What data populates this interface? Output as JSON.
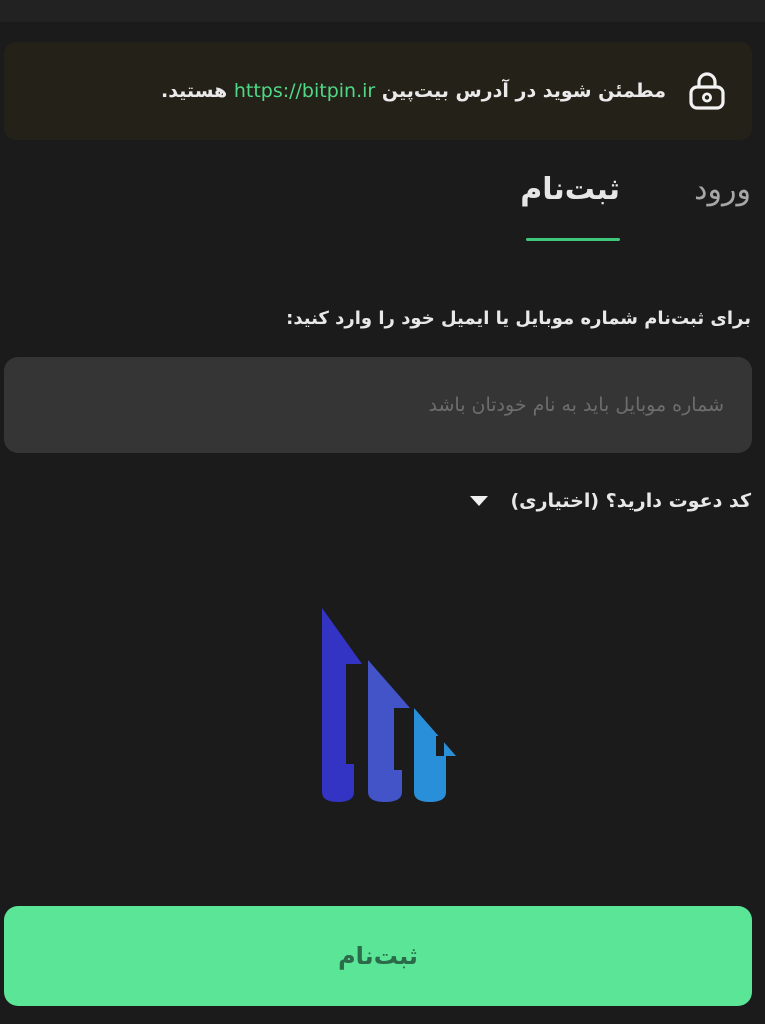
{
  "notice": {
    "text_before": "مطمئن شوید در آدرس بیت‌پین",
    "url": "https://bitpin.ir",
    "text_after": "هستید.",
    "icon": "lock-icon"
  },
  "tabs": {
    "login_label": "ورود",
    "register_label": "ثبت‌نام",
    "active": "register"
  },
  "form": {
    "phone_label": "برای ثبت‌نام شماره موبایل یا ایمیل خود را وارد کنید:",
    "phone_placeholder": "شماره موبایل باید به نام خودتان باشد",
    "phone_value": "",
    "referral_label": "کد دعوت دارید؟ (اختیاری)",
    "referral_icon": "caret-down-icon",
    "submit_label": "ثبت‌نام"
  },
  "colors": {
    "accent": "#5ae597",
    "url_green": "#4fd987",
    "background": "#1b1b1b",
    "notice_background": "#242119",
    "input_background": "#353535",
    "logo_dark_blue": "#3434c4",
    "logo_mid_blue": "#4254c8",
    "logo_light_blue": "#2a8fd9"
  },
  "logo": {
    "icon": "bitpin-logo-icon"
  }
}
